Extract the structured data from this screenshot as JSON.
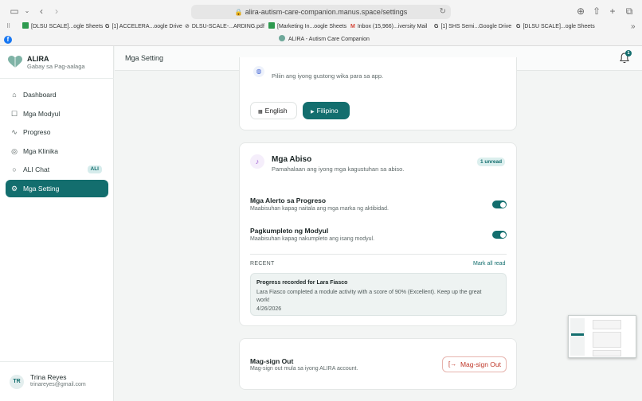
{
  "browser": {
    "url": "alira-autism-care-companion.manus.space/settings",
    "bookmarks": [
      {
        "label": "[DLSU SCALE]...ogle Sheets",
        "color": "#2e9a4f"
      },
      {
        "label": "[1] ACCELERA...oogle Drive",
        "color": "#888888"
      },
      {
        "label": "DLSU-SCALE-...ARDING.pdf",
        "color": "#888888"
      },
      {
        "label": "[Marketing In...oogle Sheets",
        "color": "#2e9a4f"
      },
      {
        "label": "Inbox (15,966)...iversity Mail",
        "color": "#d44638"
      },
      {
        "label": "[1] SHS Semi...Google Drive",
        "color": "#888888"
      },
      {
        "label": "[DLSU SCALE]...ogle Sheets",
        "color": "#888888"
      }
    ],
    "active_tab": "ALIRA - Autism Care Companion"
  },
  "sidebar": {
    "brand_name": "ALIRA",
    "brand_tagline": "Gabay sa Pag-aalaga",
    "nav": [
      {
        "label": "Dashboard",
        "icon": "home-icon",
        "glyph": "⌂",
        "active": false
      },
      {
        "label": "Mga Modyul",
        "icon": "book-icon",
        "glyph": "☐",
        "active": false
      },
      {
        "label": "Progreso",
        "icon": "activity-icon",
        "glyph": "∿",
        "active": false
      },
      {
        "label": "Mga Klinika",
        "icon": "map-pin-icon",
        "glyph": "◎",
        "active": false
      },
      {
        "label": "ALI Chat",
        "icon": "chat-icon",
        "glyph": "○",
        "active": false,
        "badge": "ALI"
      },
      {
        "label": "Mga Setting",
        "icon": "gear-icon",
        "glyph": "⚙",
        "active": true
      }
    ],
    "user": {
      "initials": "TR",
      "name": "Trina Reyes",
      "email": "trinareyes@gmail.com"
    }
  },
  "header": {
    "title": "Mga Setting",
    "notification_count": "1"
  },
  "language": {
    "subtitle": "Piliin ang iyong gustong wika para sa app.",
    "options": [
      {
        "label": "English",
        "selected": false
      },
      {
        "label": "Filipino",
        "selected": true
      }
    ]
  },
  "notifications": {
    "title": "Mga Abiso",
    "subtitle": "Pamahalaan ang iyong mga kagustuhan sa abiso.",
    "unread_badge": "1 unread",
    "settings": [
      {
        "title": "Mga Alerto sa Progreso",
        "description": "Maabisuhan kapag naitala ang mga marka ng aktibidad.",
        "enabled": true
      },
      {
        "title": "Pagkumpleto ng Modyul",
        "description": "Maabisuhan kapag nakumpleto ang isang modyul.",
        "enabled": true
      }
    ],
    "recent_label": "RECENT",
    "mark_all_read": "Mark all read",
    "recent": {
      "title": "Progress recorded for Lara Fiasco",
      "body": "Lara Fiasco completed a module activity with a score of 90% (Excellent). Keep up the great work!",
      "date": "4/26/2026"
    }
  },
  "signout": {
    "title": "Mag-sign Out",
    "subtitle": "Mag-sign out mula sa iyong ALIRA account.",
    "button_label": "Mag-sign Out"
  },
  "colors": {
    "accent": "#136e6e",
    "danger": "#c0392b"
  }
}
